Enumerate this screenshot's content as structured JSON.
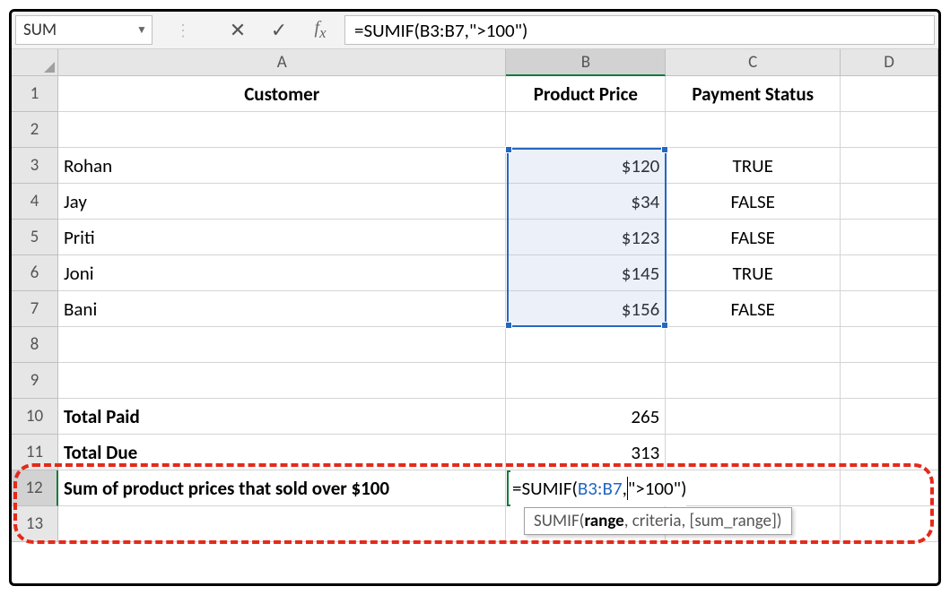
{
  "namebox": {
    "value": "SUM"
  },
  "formula_bar": {
    "text": "=SUMIF(B3:B7,\">100\")"
  },
  "columns": [
    "A",
    "B",
    "C",
    "D"
  ],
  "row_numbers": [
    "1",
    "2",
    "3",
    "4",
    "5",
    "6",
    "7",
    "8",
    "9",
    "10",
    "11",
    "12",
    "13"
  ],
  "grid": {
    "A1": "Customer",
    "B1": "Product Price",
    "C1": "Payment Status",
    "A3": "Rohan",
    "B3": "$120",
    "C3": "TRUE",
    "A4": "Jay",
    "B4": "$34",
    "C4": "FALSE",
    "A5": "Priti",
    "B5": "$123",
    "C5": "FALSE",
    "A6": "Joni",
    "B6": "$145",
    "C6": "TRUE",
    "A7": "Bani",
    "B7": "$156",
    "C7": "FALSE",
    "A10": "Total Paid",
    "B10": "265",
    "A11": "Total Due",
    "B11": "313",
    "A12": "Sum of product prices that sold over $100"
  },
  "editing": {
    "prefix": "=SUMIF(",
    "range_ref": "B3:B7",
    "middle": ",",
    "suffix": "\">100\")"
  },
  "tooltip": {
    "fn": "SUMIF(",
    "arg1": "range",
    "rest": ", criteria, [sum_range])"
  }
}
